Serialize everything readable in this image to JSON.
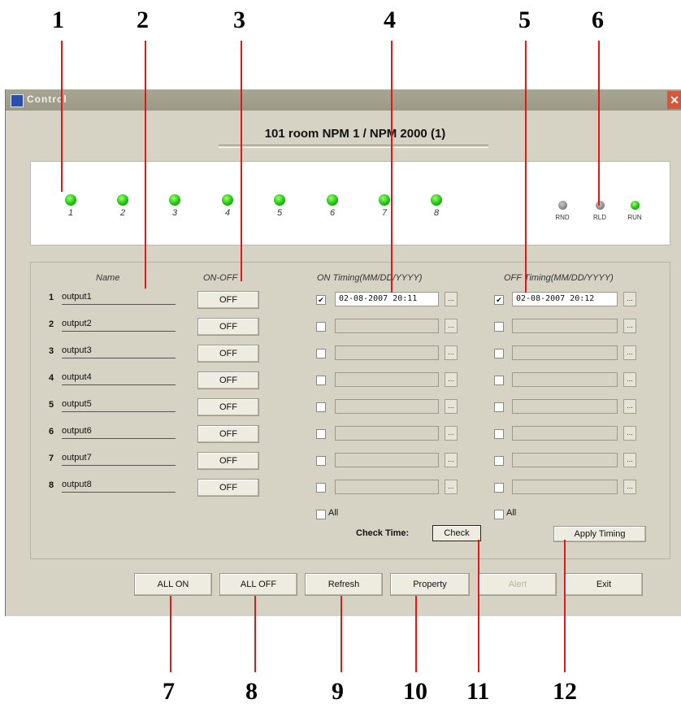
{
  "callouts": [
    "1",
    "2",
    "3",
    "4",
    "5",
    "6",
    "7",
    "8",
    "9",
    "10",
    "11",
    "12"
  ],
  "window": {
    "title": "Control",
    "close_glyph": "✕",
    "room_title": "101 room  NPM 1 / NPM 2000 (1)"
  },
  "leds": {
    "outputs": [
      {
        "label": "1",
        "state": "on"
      },
      {
        "label": "2",
        "state": "on"
      },
      {
        "label": "3",
        "state": "on"
      },
      {
        "label": "4",
        "state": "on"
      },
      {
        "label": "5",
        "state": "on"
      },
      {
        "label": "6",
        "state": "on"
      },
      {
        "label": "7",
        "state": "on"
      },
      {
        "label": "8",
        "state": "on"
      }
    ],
    "status": [
      {
        "label": "RND",
        "state": "off"
      },
      {
        "label": "RLD",
        "state": "off"
      },
      {
        "label": "RUN",
        "state": "on"
      }
    ]
  },
  "headers": {
    "name": "Name",
    "onoff": "ON-OFF",
    "on_timing": "ON Timing(MM/DD/YYYY)",
    "off_timing": "OFF Timing(MM/DD/YYYY)"
  },
  "rows": [
    {
      "num": "1",
      "name": "output1",
      "button": "OFF",
      "on_checked": "✔",
      "on_time": "02-08-2007 20:11",
      "off_checked": "✔",
      "off_time": "02-08-2007 20:12"
    },
    {
      "num": "2",
      "name": "output2",
      "button": "OFF",
      "on_checked": "",
      "on_time": "",
      "off_checked": "",
      "off_time": ""
    },
    {
      "num": "3",
      "name": "output3",
      "button": "OFF",
      "on_checked": "",
      "on_time": "",
      "off_checked": "",
      "off_time": ""
    },
    {
      "num": "4",
      "name": "output4",
      "button": "OFF",
      "on_checked": "",
      "on_time": "",
      "off_checked": "",
      "off_time": ""
    },
    {
      "num": "5",
      "name": "output5",
      "button": "OFF",
      "on_checked": "",
      "on_time": "",
      "off_checked": "",
      "off_time": ""
    },
    {
      "num": "6",
      "name": "output6",
      "button": "OFF",
      "on_checked": "",
      "on_time": "",
      "off_checked": "",
      "off_time": ""
    },
    {
      "num": "7",
      "name": "output7",
      "button": "OFF",
      "on_checked": "",
      "on_time": "",
      "off_checked": "",
      "off_time": ""
    },
    {
      "num": "8",
      "name": "output8",
      "button": "OFF",
      "on_checked": "",
      "on_time": "",
      "off_checked": "",
      "off_time": ""
    }
  ],
  "dots_label": "...",
  "all_label": "All",
  "check_time_label": "Check Time:",
  "check_button": "Check",
  "apply_timing_button": "Apply Timing",
  "bottom_buttons": {
    "all_on": "ALL ON",
    "all_off": "ALL OFF",
    "refresh": "Refresh",
    "property": "Property",
    "alert": "Alert",
    "exit": "Exit"
  },
  "colors": {
    "led_on": "#1ec60f",
    "led_off": "#8a8a8a",
    "callout_line": "#e01818",
    "window_bg": "#d6d3c4"
  }
}
